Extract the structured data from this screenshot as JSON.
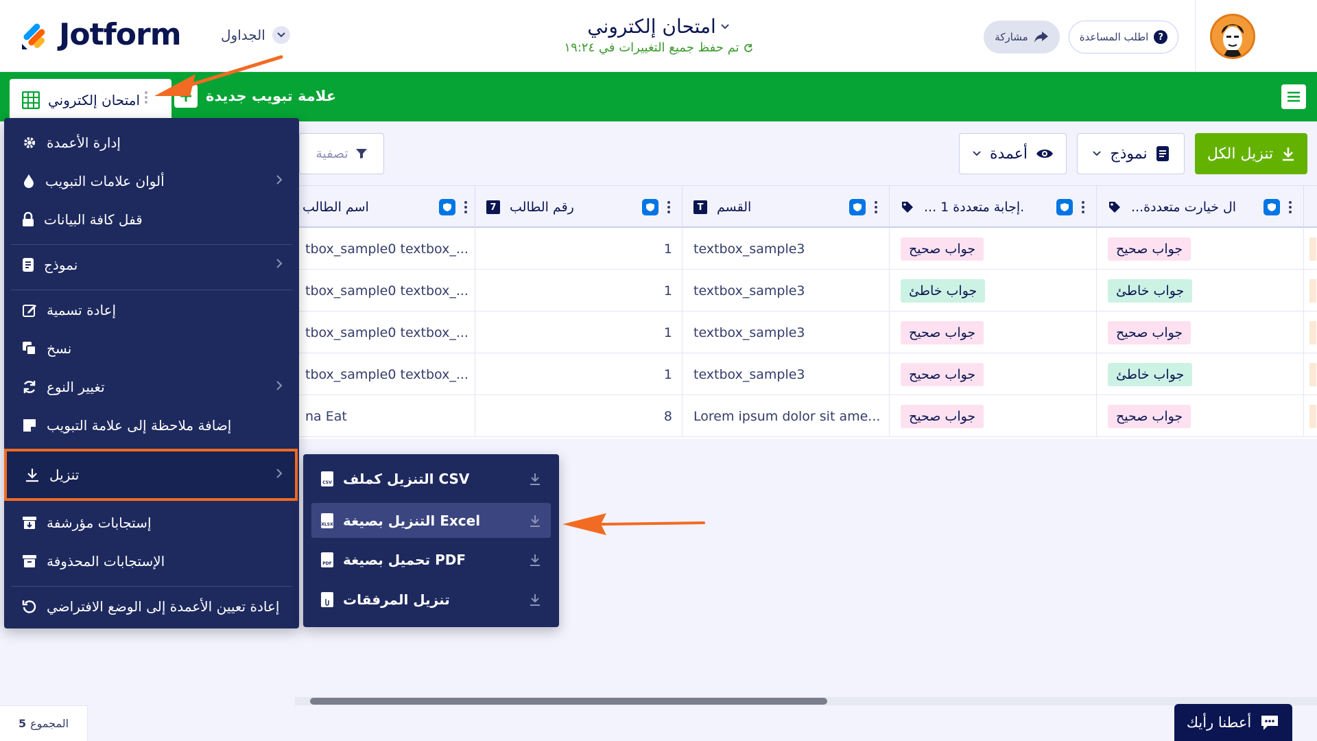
{
  "header": {
    "logo_text": "Jotform",
    "tables_label": "الجداول",
    "form_title": "امتحان إلكتروني",
    "save_status": "تم حفظ جميع التغييرات في ١٩:٢٤",
    "share_label": "مشاركة",
    "help_label": "اطلب المساعدة"
  },
  "tabbar": {
    "active_tab": "امتحان إلكتروني",
    "new_tab": "علامة تبويب جديدة"
  },
  "toolbar": {
    "filter": "تصفية",
    "columns": "أعمدة",
    "form": "نموذج",
    "download_all": "تنزيل الكل"
  },
  "table": {
    "columns": [
      "اسم الطالب",
      "رقم الطالب",
      "القسم",
      "... إجابة متعددة 1.",
      "...ال خيارت متعددة"
    ],
    "column_type_badges": [
      "",
      "7",
      "T",
      "",
      ""
    ],
    "rows": [
      {
        "name": "tbox_sample0 textbox_...",
        "number": "1",
        "section": "textbox_sample3",
        "a1": "جواب صحيح",
        "a1_type": "correct",
        "a2": "جواب صحيح",
        "a2_type": "correct"
      },
      {
        "name": "tbox_sample0 textbox_...",
        "number": "1",
        "section": "textbox_sample3",
        "a1": "جواب خاطئ",
        "a1_type": "wrong",
        "a2": "جواب خاطئ",
        "a2_type": "wrong"
      },
      {
        "name": "tbox_sample0 textbox_...",
        "number": "1",
        "section": "textbox_sample3",
        "a1": "جواب صحيح",
        "a1_type": "correct",
        "a2": "جواب صحيح",
        "a2_type": "correct"
      },
      {
        "name": "tbox_sample0 textbox_...",
        "number": "1",
        "section": "textbox_sample3",
        "a1": "جواب صحيح",
        "a1_type": "correct",
        "a2": "جواب خاطئ",
        "a2_type": "wrong"
      },
      {
        "name": "na Eat",
        "number": "8",
        "section": "Lorem ipsum dolor sit ame...",
        "a1": "جواب صحيح",
        "a1_type": "correct",
        "a2": "جواب صحيح",
        "a2_type": "correct"
      }
    ]
  },
  "menu": {
    "items": [
      "إدارة الأعمدة",
      "ألوان علامات التبويب",
      "قفل كافة البيانات",
      "نموذج",
      "إعادة تسمية",
      "نسخ",
      "تغيير النوع",
      "إضافة ملاحظة إلى علامة التبويب",
      "تنزيل",
      "إستجابات مؤرشفة",
      "الإستجابات المحذوفة",
      "إعادة تعيين الأعمدة إلى الوضع الافتراضي"
    ]
  },
  "submenu": {
    "items": [
      "التنزيل كملف CSV",
      "التنزيل بصيغة Excel",
      "تحميل بصيغة PDF",
      "تنزيل المرفقات"
    ],
    "file_badges": [
      "CSV",
      "XLSX",
      "PDF",
      ""
    ]
  },
  "footer": {
    "total_label": "المجموع",
    "total_value": "5",
    "feedback": "أعطنا رأيك"
  },
  "colors": {
    "green_bar": "#05a434",
    "download_green": "#64b200",
    "menu_bg": "#1e2a5e",
    "highlight_orange": "#f26b22",
    "navy": "#0a1551"
  }
}
